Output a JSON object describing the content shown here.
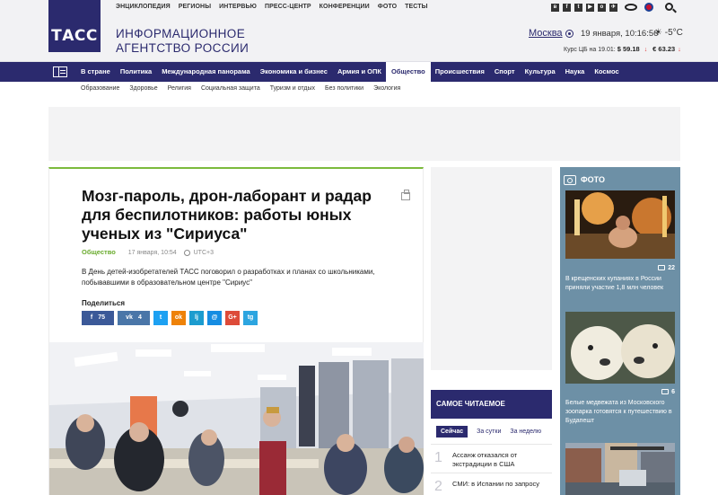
{
  "brand": {
    "logo_text": "ТАСС",
    "line1": "ИНФОРМАЦИОННОЕ",
    "line2": "АГЕНТСТВО РОССИИ"
  },
  "topnav": [
    "ЭНЦИКЛОПЕДИЯ",
    "РЕГИОНЫ",
    "ИНТЕРВЬЮ",
    "ПРЕСС-ЦЕНТР",
    "КОНФЕРЕНЦИИ",
    "ФОТО",
    "ТЕСТЫ"
  ],
  "social_icons": [
    "vk-icon",
    "facebook-icon",
    "twitter-icon",
    "youtube-icon",
    "odnoklassniki-icon",
    "telegram-icon"
  ],
  "location": {
    "city": "Москва",
    "datetime": "19 января, 10:16:56",
    "weather": "-5°C"
  },
  "rates": {
    "label": "Курс ЦБ на 19.01:",
    "usd": "$ 59.18",
    "eur": "€ 63.23"
  },
  "mainnav": {
    "items": [
      "В стране",
      "Политика",
      "Международная панорама",
      "Экономика и бизнес",
      "Армия и ОПК",
      "Общество",
      "Происшествия",
      "Спорт",
      "Культура",
      "Наука",
      "Космос"
    ],
    "active": "Общество"
  },
  "subnav": [
    "Образование",
    "Здоровье",
    "Религия",
    "Социальная защита",
    "Туризм и отдых",
    "Без политики",
    "Экология"
  ],
  "article": {
    "title": "Мозг-пароль, дрон-лаборант и радар для беспилотников: работы юных ученых из \"Сириуса\"",
    "rubric": "Общество",
    "date": "17 января, 10:54",
    "timezone": "UTC+3",
    "lead": "В День детей-изобретателей ТАСС поговорил о разработках и планах со школьниками, побывавшими в образовательном центре \"Сириус\"",
    "share_label": "Поделиться",
    "share": [
      {
        "id": "facebook",
        "label": "f",
        "count": "75",
        "color": "#3b5998"
      },
      {
        "id": "vk",
        "label": "vk",
        "count": "4",
        "color": "#4a76a8"
      },
      {
        "id": "twitter",
        "label": "t",
        "count": "",
        "color": "#1da1f2"
      },
      {
        "id": "odnoklassniki",
        "label": "ok",
        "count": "",
        "color": "#ee8208"
      },
      {
        "id": "livejournal",
        "label": "lj",
        "count": "",
        "color": "#1c9ccf"
      },
      {
        "id": "mail",
        "label": "@",
        "count": "",
        "color": "#168de2"
      },
      {
        "id": "googleplus",
        "label": "G+",
        "count": "",
        "color": "#dd4b39"
      },
      {
        "id": "telegram",
        "label": "tg",
        "count": "",
        "color": "#2ca5e0"
      }
    ]
  },
  "popular": {
    "title": "САМОЕ ЧИТАЕМОЕ",
    "tabs": [
      "Сейчас",
      "За сутки",
      "За неделю"
    ],
    "active_tab": "Сейчас",
    "items": [
      {
        "num": "1",
        "text": "Ассанж отказался от экстрадиции в США"
      },
      {
        "num": "2",
        "text": "СМИ: в Испании по запросу"
      }
    ]
  },
  "photo": {
    "title": "ФОТО",
    "items": [
      {
        "caption": "В крещенских купаниях в России приняли участие 1,8 млн человек",
        "count": "22"
      },
      {
        "caption": "Белые медвежата из Московского зоопарка готовятся к путешествию в Будапешт",
        "count": "6"
      },
      {
        "caption": "",
        "count": ""
      }
    ]
  },
  "colors": {
    "brand": "#2b2a6e",
    "accent_green": "#7cba3c",
    "photo_bg": "#6d90a6"
  }
}
